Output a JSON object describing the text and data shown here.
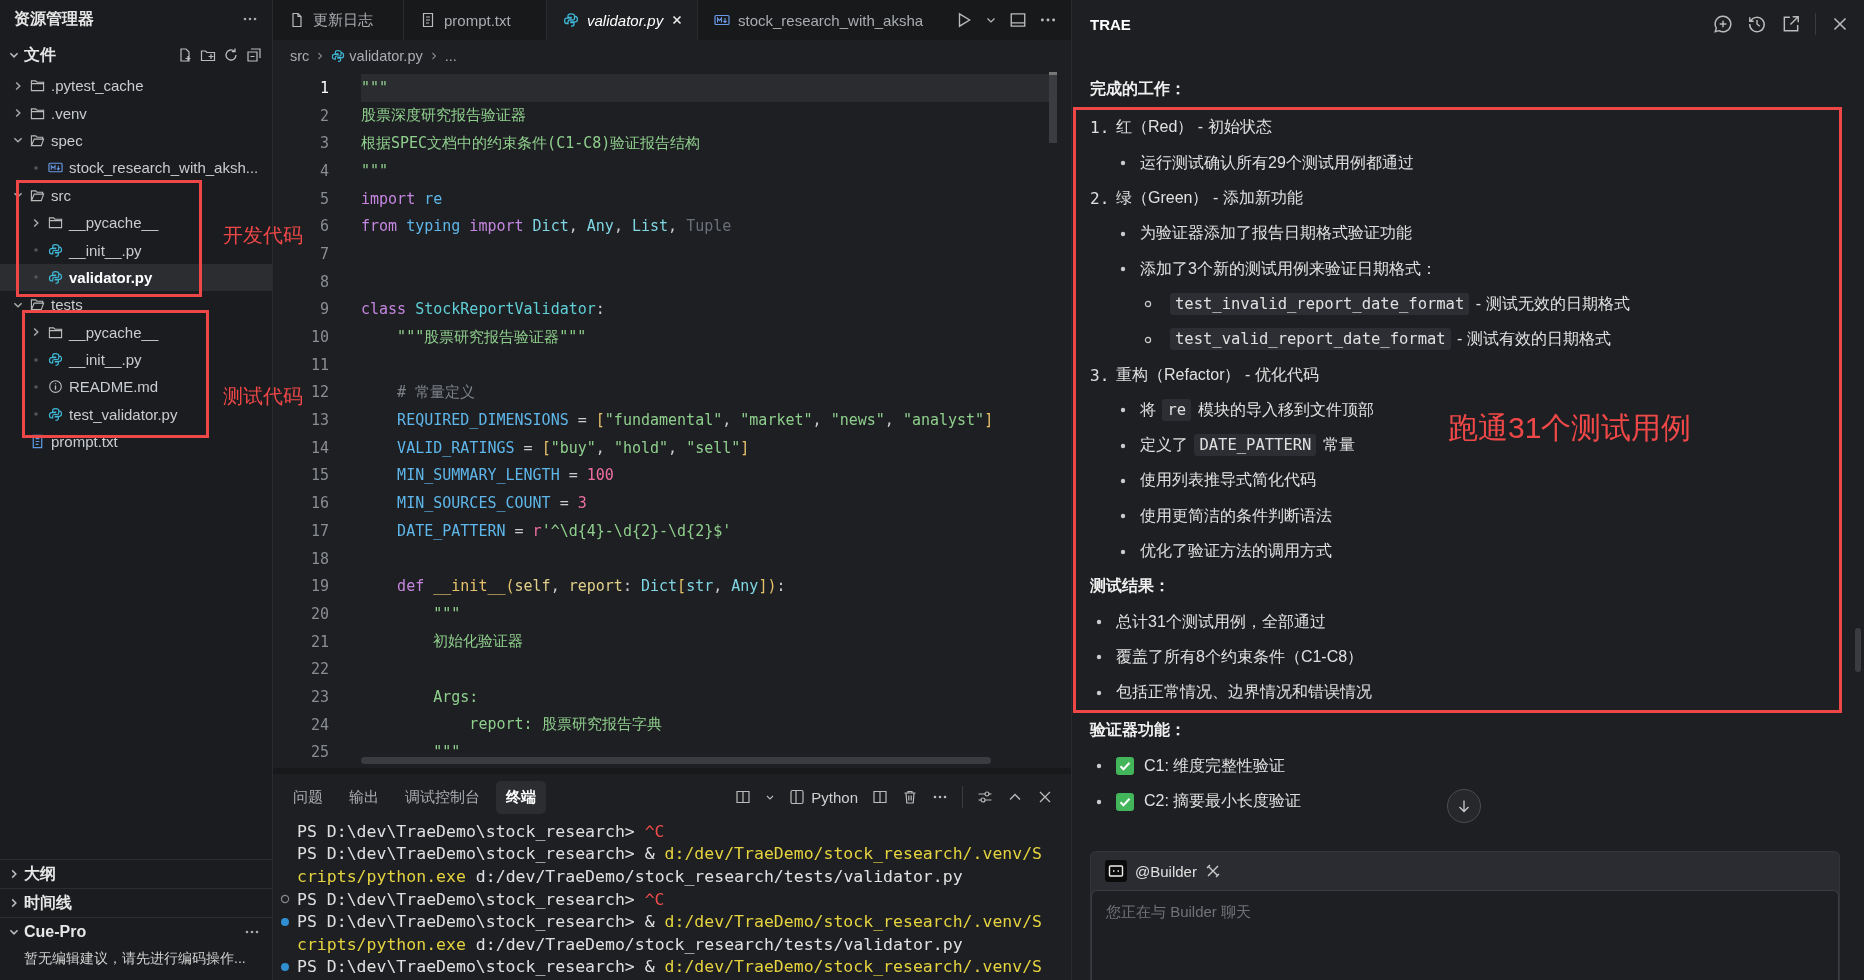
{
  "sidebar": {
    "title": "资源管理器",
    "section": "文件",
    "tree": [
      {
        "label": ".pytest_cache",
        "kind": "folder",
        "expanded": false,
        "selected": false
      },
      {
        "label": ".venv",
        "kind": "folder",
        "expanded": false,
        "selected": false
      },
      {
        "label": "spec",
        "kind": "folder",
        "expanded": true,
        "selected": false,
        "children": [
          {
            "label": "stock_research_with_aksh...",
            "kind": "md",
            "selected": false
          }
        ]
      },
      {
        "label": "src",
        "kind": "folder",
        "expanded": true,
        "selected": false,
        "annotation": {
          "label": "开发代码",
          "kind": "whole"
        },
        "children": [
          {
            "label": "__pycache__",
            "kind": "folder",
            "expanded": false,
            "selected": false
          },
          {
            "label": "__init__.py",
            "kind": "py",
            "selected": false
          },
          {
            "label": "validator.py",
            "kind": "py",
            "selected": true
          }
        ]
      },
      {
        "label": "tests",
        "kind": "folder",
        "expanded": true,
        "selected": false,
        "annotation": {
          "label": "测试代码",
          "kind": "children"
        },
        "children": [
          {
            "label": "__pycache__",
            "kind": "folder",
            "expanded": false,
            "selected": false
          },
          {
            "label": "__init__.py",
            "kind": "py",
            "selected": false
          },
          {
            "label": "README.md",
            "kind": "info",
            "selected": false
          },
          {
            "label": "test_validator.py",
            "kind": "py",
            "selected": false
          }
        ]
      },
      {
        "label": "prompt.txt",
        "kind": "txt",
        "selected": false
      }
    ],
    "sections": [
      {
        "label": "大纲",
        "expanded": false
      },
      {
        "label": "时间线",
        "expanded": false
      },
      {
        "label": "Cue-Pro",
        "expanded": true
      }
    ],
    "cue_message": "暂无编辑建议，请先进行编码操作..."
  },
  "editor": {
    "tabs": [
      {
        "label": "更新日志",
        "kind": "doc",
        "selected": false
      },
      {
        "label": "prompt.txt",
        "kind": "txt",
        "selected": false
      },
      {
        "label": "validator.py",
        "kind": "py",
        "selected": true
      },
      {
        "label": "stock_research_with_aksha",
        "kind": "md",
        "selected": false
      }
    ],
    "breadcrumb": [
      {
        "label": "src",
        "kind": "folder"
      },
      {
        "label": "validator.py",
        "kind": "py"
      },
      {
        "label": "...",
        "kind": "more"
      }
    ],
    "lines": [
      {
        "n": "1",
        "current": true,
        "tokens": [
          {
            "kind": "str",
            "text": "\"\"\""
          }
        ]
      },
      {
        "n": "2",
        "current": false,
        "tokens": [
          {
            "kind": "str",
            "text": "股票深度研究报告验证器"
          }
        ]
      },
      {
        "n": "3",
        "current": false,
        "tokens": [
          {
            "kind": "str",
            "text": "根据SPEC文档中的约束条件(C1-C8)验证报告结构"
          }
        ]
      },
      {
        "n": "4",
        "current": false,
        "tokens": [
          {
            "kind": "str",
            "text": "\"\"\""
          }
        ]
      },
      {
        "n": "5",
        "current": false,
        "tokens": [
          {
            "kind": "kw",
            "text": "import"
          },
          {
            "kind": "name",
            "text": " re"
          }
        ]
      },
      {
        "n": "6",
        "current": false,
        "tokens": [
          {
            "kind": "kw",
            "text": "from"
          },
          {
            "kind": "name",
            "text": " typing"
          },
          {
            "kind": "kw",
            "text": " import"
          },
          {
            "kind": "type",
            "text": " Dict"
          },
          {
            "kind": "plain",
            "text": ", "
          },
          {
            "kind": "type",
            "text": "Any"
          },
          {
            "kind": "plain",
            "text": ", "
          },
          {
            "kind": "type",
            "text": "List"
          },
          {
            "kind": "plain",
            "text": ", "
          },
          {
            "kind": "dim",
            "text": "Tuple"
          }
        ]
      },
      {
        "n": "7",
        "current": false
      },
      {
        "n": "8",
        "current": false
      },
      {
        "n": "9",
        "current": false,
        "tokens": [
          {
            "kind": "kw",
            "text": "class"
          },
          {
            "kind": "cls",
            "text": " StockReportValidator"
          },
          {
            "kind": "plain",
            "text": ":"
          }
        ]
      },
      {
        "n": "10",
        "current": false,
        "tokens": [
          {
            "kind": "str",
            "text": "    \"\"\"股票研究报告验证器\"\"\""
          }
        ]
      },
      {
        "n": "11",
        "current": false
      },
      {
        "n": "12",
        "current": false,
        "tokens": [
          {
            "kind": "comment",
            "text": "    # 常量定义"
          }
        ]
      },
      {
        "n": "13",
        "current": false,
        "tokens": [
          {
            "kind": "name",
            "text": "    REQUIRED_DIMENSIONS"
          },
          {
            "kind": "plain",
            "text": " = "
          },
          {
            "kind": "bracket",
            "text": "["
          },
          {
            "kind": "str",
            "text": "\"fundamental\""
          },
          {
            "kind": "plain",
            "text": ", "
          },
          {
            "kind": "str",
            "text": "\"market\""
          },
          {
            "kind": "plain",
            "text": ", "
          },
          {
            "kind": "str",
            "text": "\"news\""
          },
          {
            "kind": "plain",
            "text": ", "
          },
          {
            "kind": "str",
            "text": "\"analyst\""
          },
          {
            "kind": "bracket",
            "text": "]"
          }
        ]
      },
      {
        "n": "14",
        "current": false,
        "tokens": [
          {
            "kind": "name",
            "text": "    VALID_RATINGS"
          },
          {
            "kind": "plain",
            "text": " = "
          },
          {
            "kind": "bracket",
            "text": "["
          },
          {
            "kind": "str",
            "text": "\"buy\""
          },
          {
            "kind": "plain",
            "text": ", "
          },
          {
            "kind": "str",
            "text": "\"hold\""
          },
          {
            "kind": "plain",
            "text": ", "
          },
          {
            "kind": "str",
            "text": "\"sell\""
          },
          {
            "kind": "bracket",
            "text": "]"
          }
        ]
      },
      {
        "n": "15",
        "current": false,
        "tokens": [
          {
            "kind": "name",
            "text": "    MIN_SUMMARY_LENGTH"
          },
          {
            "kind": "plain",
            "text": " = "
          },
          {
            "kind": "num",
            "text": "100"
          }
        ]
      },
      {
        "n": "16",
        "current": false,
        "tokens": [
          {
            "kind": "name",
            "text": "    MIN_SOURCES_COUNT"
          },
          {
            "kind": "plain",
            "text": " = "
          },
          {
            "kind": "num",
            "text": "3"
          }
        ]
      },
      {
        "n": "17",
        "current": false,
        "tokens": [
          {
            "kind": "name",
            "text": "    DATE_PATTERN"
          },
          {
            "kind": "plain",
            "text": " = "
          },
          {
            "kind": "num",
            "text": "r"
          },
          {
            "kind": "str",
            "text": "'^\\d{4}-\\d{2}-\\d{2}$'"
          }
        ]
      },
      {
        "n": "18",
        "current": false
      },
      {
        "n": "19",
        "current": false,
        "tokens": [
          {
            "kind": "kw",
            "text": "    def"
          },
          {
            "kind": "fn",
            "text": " __init__"
          },
          {
            "kind": "bracket",
            "text": "("
          },
          {
            "kind": "param",
            "text": "self"
          },
          {
            "kind": "plain",
            "text": ", "
          },
          {
            "kind": "param",
            "text": "report"
          },
          {
            "kind": "plain",
            "text": ": "
          },
          {
            "kind": "type",
            "text": "Dict"
          },
          {
            "kind": "bracket",
            "text": "["
          },
          {
            "kind": "type",
            "text": "str"
          },
          {
            "kind": "plain",
            "text": ", "
          },
          {
            "kind": "type",
            "text": "Any"
          },
          {
            "kind": "bracket",
            "text": "])"
          },
          {
            "kind": "plain",
            "text": ":"
          }
        ]
      },
      {
        "n": "20",
        "current": false,
        "tokens": [
          {
            "kind": "str",
            "text": "        \"\"\""
          }
        ]
      },
      {
        "n": "21",
        "current": false,
        "tokens": [
          {
            "kind": "str",
            "text": "        初始化验证器"
          }
        ]
      },
      {
        "n": "22",
        "current": false
      },
      {
        "n": "23",
        "current": false,
        "tokens": [
          {
            "kind": "str",
            "text": "        Args:"
          }
        ]
      },
      {
        "n": "24",
        "current": false,
        "tokens": [
          {
            "kind": "str",
            "text": "            report: 股票研究报告字典"
          }
        ]
      },
      {
        "n": "25",
        "current": false,
        "tokens": [
          {
            "kind": "str",
            "text": "        \"\"\""
          }
        ]
      }
    ]
  },
  "panel": {
    "tabs": [
      {
        "label": "问题",
        "selected": false
      },
      {
        "label": "输出",
        "selected": false
      },
      {
        "label": "调试控制台",
        "selected": false
      },
      {
        "label": "终端",
        "selected": true
      }
    ],
    "shell": "Python",
    "lines": [
      {
        "kind": "plain",
        "segs": [
          {
            "kind": "plain",
            "text": "PS D:\\dev\\TraeDemo\\stock_research> "
          },
          {
            "kind": "err",
            "text": "^C"
          }
        ]
      },
      {
        "kind": "plain",
        "segs": [
          {
            "kind": "plain",
            "text": "PS D:\\dev\\TraeDemo\\stock_research> & "
          },
          {
            "kind": "warn",
            "text": "d:/dev/TraeDemo/stock_research/.venv/S"
          }
        ]
      },
      {
        "kind": "plain",
        "segs": [
          {
            "kind": "warn",
            "text": "cripts/python.exe"
          },
          {
            "kind": "plain",
            "text": " d:/dev/TraeDemo/stock_research/tests/validator.py"
          }
        ]
      },
      {
        "kind": "hollow",
        "segs": [
          {
            "kind": "plain",
            "text": "PS D:\\dev\\TraeDemo\\stock_research> "
          },
          {
            "kind": "err",
            "text": "^C"
          }
        ]
      },
      {
        "kind": "filled",
        "segs": [
          {
            "kind": "plain",
            "text": "PS D:\\dev\\TraeDemo\\stock_research> & "
          },
          {
            "kind": "warn",
            "text": "d:/dev/TraeDemo/stock_research/.venv/S"
          }
        ]
      },
      {
        "kind": "plain",
        "segs": [
          {
            "kind": "warn",
            "text": "cripts/python.exe"
          },
          {
            "kind": "plain",
            "text": " d:/dev/TraeDemo/stock_research/tests/validator.py"
          }
        ]
      },
      {
        "kind": "filled",
        "segs": [
          {
            "kind": "plain",
            "text": "PS D:\\dev\\TraeDemo\\stock_research> & "
          },
          {
            "kind": "warn",
            "text": "d:/dev/TraeDemo/stock_research/.venv/S"
          }
        ]
      }
    ]
  },
  "assistant": {
    "title": "TRAE",
    "content": [
      {
        "kind": "heading",
        "parts": [
          {
            "kind": "text",
            "text": "完成的工作："
          }
        ]
      },
      {
        "kind": "annotated",
        "label": "跑通31个测试用例",
        "items": [
          {
            "kind": "step",
            "number": "1.",
            "parts": [
              {
                "kind": "text",
                "text": "红（Red） - 初始状态"
              }
            ]
          },
          {
            "kind": "bullet",
            "parts": [
              {
                "kind": "text",
                "text": "运行测试确认所有29个测试用例都通过"
              }
            ]
          },
          {
            "kind": "step",
            "number": "2.",
            "parts": [
              {
                "kind": "text",
                "text": "绿（Green） - 添加新功能"
              }
            ]
          },
          {
            "kind": "bullet",
            "parts": [
              {
                "kind": "text",
                "text": "为验证器添加了报告日期格式验证功能"
              }
            ]
          },
          {
            "kind": "bullet",
            "parts": [
              {
                "kind": "text",
                "text": "添加了3个新的测试用例来验证日期格式："
              }
            ]
          },
          {
            "kind": "subbullet",
            "parts": [
              {
                "kind": "code",
                "text": "test_invalid_report_date_format"
              },
              {
                "kind": "text",
                "text": " - 测试无效的日期格式"
              }
            ]
          },
          {
            "kind": "subbullet",
            "parts": [
              {
                "kind": "code",
                "text": "test_valid_report_date_format"
              },
              {
                "kind": "text",
                "text": " - 测试有效的日期格式"
              }
            ]
          },
          {
            "kind": "step",
            "number": "3.",
            "parts": [
              {
                "kind": "text",
                "text": "重构（Refactor） - 优化代码"
              }
            ]
          },
          {
            "kind": "bullet",
            "parts": [
              {
                "kind": "text",
                "text": "将 "
              },
              {
                "kind": "code",
                "text": "re"
              },
              {
                "kind": "text",
                "text": " 模块的导入移到文件顶部"
              }
            ]
          },
          {
            "kind": "bullet",
            "parts": [
              {
                "kind": "text",
                "text": "定义了 "
              },
              {
                "kind": "code",
                "text": "DATE_PATTERN"
              },
              {
                "kind": "text",
                "text": " 常量"
              }
            ]
          },
          {
            "kind": "bullet",
            "parts": [
              {
                "kind": "text",
                "text": "使用列表推导式简化代码"
              }
            ]
          },
          {
            "kind": "bullet",
            "parts": [
              {
                "kind": "text",
                "text": "使用更简洁的条件判断语法"
              }
            ]
          },
          {
            "kind": "bullet",
            "parts": [
              {
                "kind": "text",
                "text": "优化了验证方法的调用方式"
              }
            ]
          },
          {
            "kind": "heading",
            "parts": [
              {
                "kind": "text",
                "text": "测试结果："
              }
            ]
          },
          {
            "kind": "point",
            "parts": [
              {
                "kind": "text",
                "text": "总计31个测试用例，全部通过"
              }
            ]
          },
          {
            "kind": "point",
            "parts": [
              {
                "kind": "text",
                "text": "覆盖了所有8个约束条件（C1-C8）"
              }
            ]
          },
          {
            "kind": "point",
            "parts": [
              {
                "kind": "text",
                "text": "包括正常情况、边界情况和错误情况"
              }
            ]
          }
        ]
      },
      {
        "kind": "heading",
        "parts": [
          {
            "kind": "text",
            "text": "验证器功能："
          }
        ]
      },
      {
        "kind": "check",
        "checked": true,
        "parts": [
          {
            "kind": "text",
            "text": "C1: 维度完整性验证"
          }
        ]
      },
      {
        "kind": "check",
        "checked": true,
        "parts": [
          {
            "kind": "text",
            "text": "C2: 摘要最小长度验证"
          }
        ]
      }
    ],
    "chat": {
      "agent": "@Builder",
      "placeholder": "您正在与 Builder 聊天"
    }
  }
}
